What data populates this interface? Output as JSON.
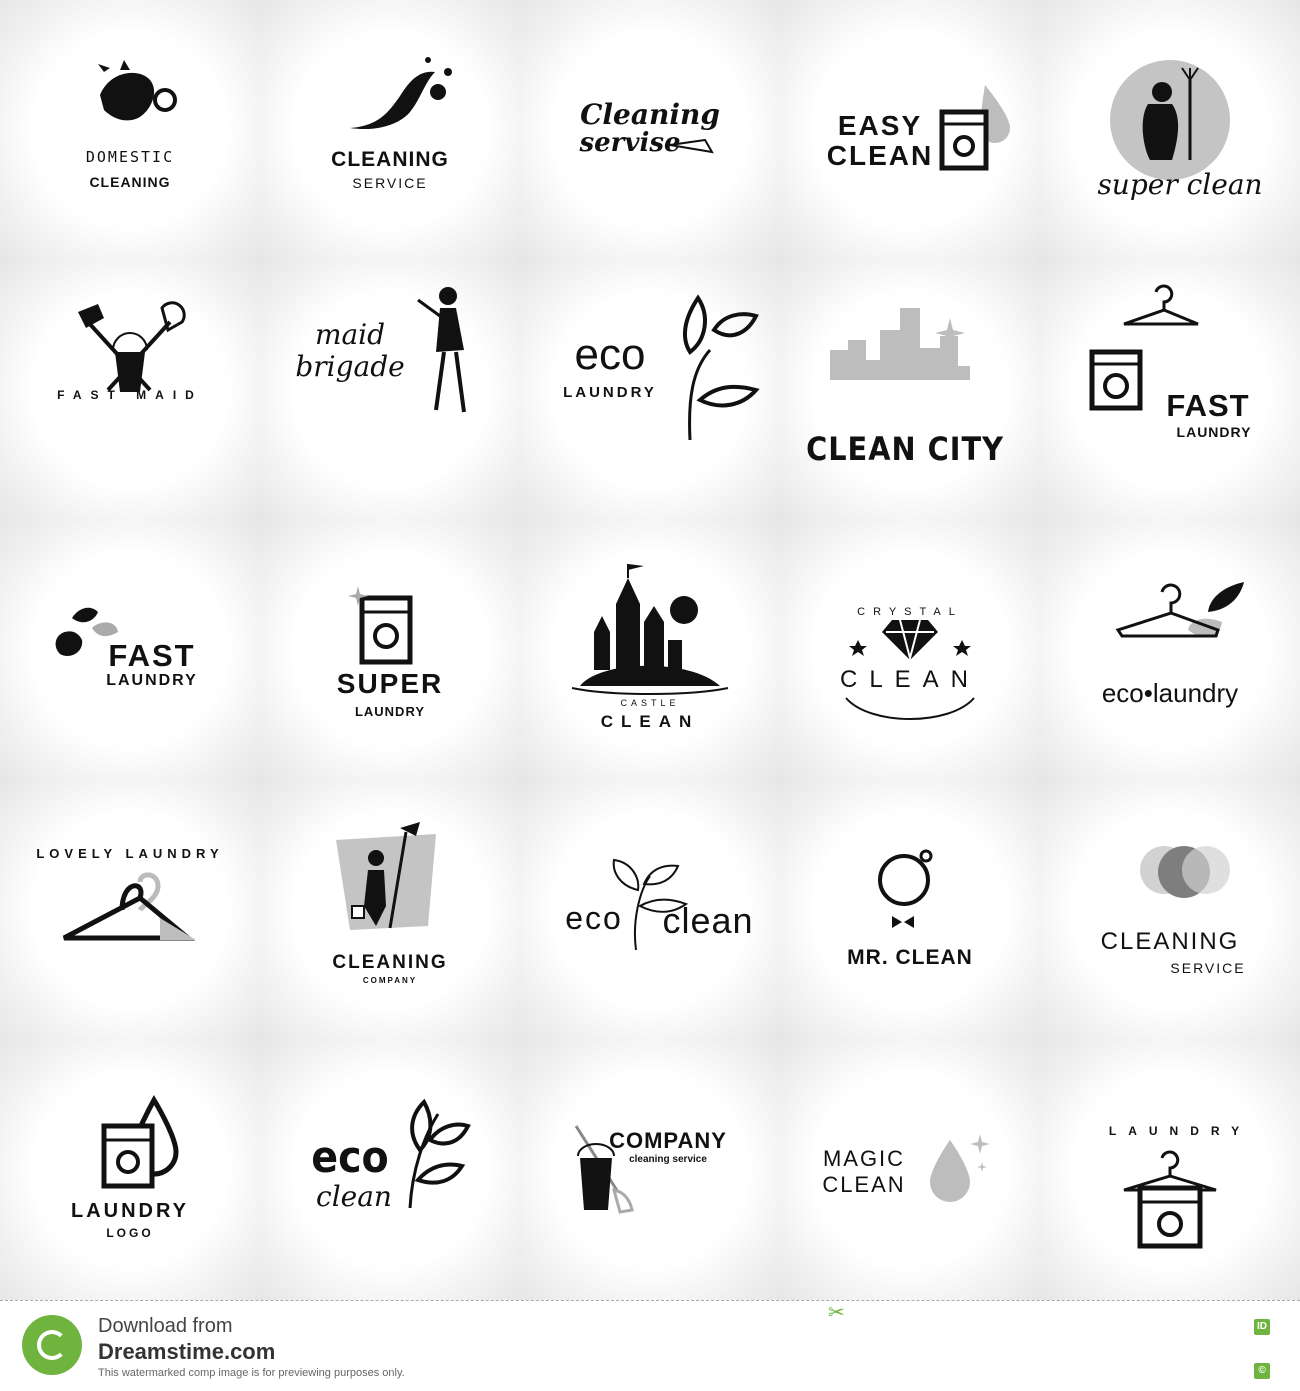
{
  "logos": {
    "domestic_cleaning": {
      "line1": "DOMESTIC",
      "line2": "CLEANING"
    },
    "cleaning_service_splash": {
      "line1": "CLEANING",
      "line2": "SERVICE"
    },
    "cleaning_servise_script": {
      "line1": "Cleaning",
      "line2": "servise"
    },
    "easy_clean": {
      "line1": "EASY",
      "line2": "CLEAN"
    },
    "super_clean_script": {
      "line1": "super clean"
    },
    "fast_maid": {
      "line1": "FAST MAID"
    },
    "maid_brigade": {
      "line1": "maid",
      "line2": "brigade"
    },
    "eco_laundry_leaf": {
      "line1": "eco",
      "line2": "LAUNDRY"
    },
    "clean_city": {
      "line1": "CLEAN CITY"
    },
    "fast_laundry_hanger": {
      "line1": "FAST",
      "line2": "LAUNDRY"
    },
    "fast_laundry_drops": {
      "line1": "FAST",
      "line2": "LAUNDRY"
    },
    "super_laundry": {
      "line1": "SUPER",
      "line2": "LAUNDRY"
    },
    "castle_clean": {
      "line1": "CASTLE",
      "line2": "CLEAN"
    },
    "crystal_clean": {
      "line1": "CRYSTAL",
      "line2": "CLEAN"
    },
    "eco_laundry_hanger": {
      "line1": "eco•laundry"
    },
    "lovely_laundry": {
      "line1": "LOVELY LAUNDRY"
    },
    "cleaning_company": {
      "line1": "CLEANING",
      "line2": "COMPANY"
    },
    "eco_clean_leaf": {
      "line1": "eco",
      "line2": "clean"
    },
    "mr_clean": {
      "line1": "MR. CLEAN"
    },
    "cleaning_service_circles": {
      "line1": "CLEANING",
      "line2": "SERVICE"
    },
    "laundry_logo": {
      "line1": "LAUNDRY",
      "line2": "LOGO"
    },
    "eco_clean_script": {
      "line1": "eco",
      "line2": "clean"
    },
    "company_mop": {
      "line1": "COMPANY",
      "line2": "cleaning service"
    },
    "magic_clean": {
      "line1": "MAGIC",
      "line2": "CLEAN"
    },
    "laundry_arc": {
      "line1": "LAUNDRY"
    }
  },
  "footer": {
    "download_from": "Download from",
    "site": "Dreamstime.com",
    "notice": "This watermarked comp image is for previewing purposes only.",
    "side_id": "ID",
    "side_c": "©"
  },
  "colors": {
    "ink": "#111111",
    "grey": "#a8a8a8",
    "brand_green": "#6fb43f"
  }
}
